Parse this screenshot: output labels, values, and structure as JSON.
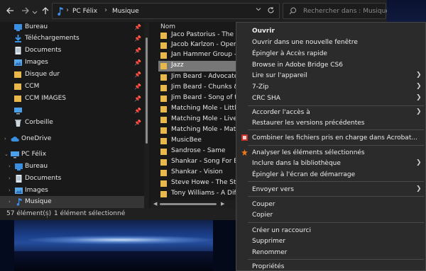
{
  "toolbar": {
    "breadcrumb": [
      "PC Félix",
      "Musique"
    ],
    "search_placeholder": "Rechercher dans : Musique"
  },
  "nav": {
    "quick_access": [
      {
        "label": "Bureau",
        "icon": "desktop-folder-icon",
        "pinned": true
      },
      {
        "label": "Téléchargements",
        "icon": "downloads-icon",
        "pinned": true
      },
      {
        "label": "Documents",
        "icon": "documents-icon",
        "pinned": true
      },
      {
        "label": "Images",
        "icon": "pictures-icon",
        "pinned": true
      },
      {
        "label": "Disque dur",
        "icon": "folder-icon",
        "pinned": true
      },
      {
        "label": "CCM",
        "icon": "folder-icon",
        "pinned": true
      },
      {
        "label": "CCM IMAGES",
        "icon": "folder-icon",
        "pinned": true
      },
      {
        "label": "",
        "icon": "monitor-icon",
        "pinned": true
      },
      {
        "label": "Corbeille",
        "icon": "recycle-bin-icon",
        "pinned": true
      }
    ],
    "onedrive": "OneDrive",
    "pc": "PC Félix",
    "pc_items": [
      {
        "label": "Bureau",
        "icon": "desktop-folder-icon"
      },
      {
        "label": "Documents",
        "icon": "documents-icon"
      },
      {
        "label": "Images",
        "icon": "pictures-icon"
      },
      {
        "label": "Musique",
        "icon": "music-icon",
        "selected": true
      }
    ]
  },
  "files": {
    "column_header": "Nom",
    "rows": [
      {
        "name": "Jaco Pastorius - The Flor"
      },
      {
        "name": "Jacob Karlzon - Open W"
      },
      {
        "name": "Jan Hammer Group - Liv"
      },
      {
        "name": "Jazz",
        "selected": true
      },
      {
        "name": "Jim Beard - Advocate"
      },
      {
        "name": "Jim Beard - Chunks & Ch"
      },
      {
        "name": "Jim Beard - Song of the"
      },
      {
        "name": "Matching Mole - Little R"
      },
      {
        "name": "Matching Mole - Live In"
      },
      {
        "name": "Matching Mole - Matchi"
      },
      {
        "name": "MusicBee"
      },
      {
        "name": "Sandrose - Same"
      },
      {
        "name": "Shankar - Song For Ever"
      },
      {
        "name": "Shankar - Vision"
      },
      {
        "name": "Steve Howe - The Steve"
      },
      {
        "name": "Tony Williams - A Differe"
      }
    ]
  },
  "status": {
    "count": "57 élément(s)",
    "selection": "1 élément sélectionné"
  },
  "context_menu": {
    "items": [
      {
        "label": "Ouvrir",
        "bold": true
      },
      {
        "label": "Ouvrir dans une nouvelle fenêtre"
      },
      {
        "label": "Épingler à Accès rapide"
      },
      {
        "label": "Browse in Adobe Bridge CS6"
      },
      {
        "label": "Lire sur l'appareil",
        "submenu": true
      },
      {
        "label": "7-Zip",
        "submenu": true
      },
      {
        "label": "CRC SHA",
        "submenu": true
      },
      {
        "label": "Accorder l'accès à",
        "submenu": true
      },
      {
        "label": "Restaurer les versions précédentes"
      },
      {
        "label": "Combiner les fichiers pris en charge dans Acrobat...",
        "icon": "acrobat-icon"
      },
      {
        "label": "Analyser les éléments sélectionnés",
        "icon": "antivirus-icon"
      },
      {
        "label": "Inclure dans la bibliothèque",
        "submenu": true
      },
      {
        "label": "Épingler à l'écran de démarrage"
      },
      {
        "label": "Envoyer vers",
        "submenu": true
      },
      {
        "label": "Couper"
      },
      {
        "label": "Copier"
      },
      {
        "label": "Créer un raccourci"
      },
      {
        "label": "Supprimer"
      },
      {
        "label": "Renommer"
      },
      {
        "label": "Propriétés"
      }
    ]
  },
  "colors": {
    "folder": "#e8b84a",
    "selected_row": "#777777",
    "menu_bg": "#2b2b2b"
  }
}
